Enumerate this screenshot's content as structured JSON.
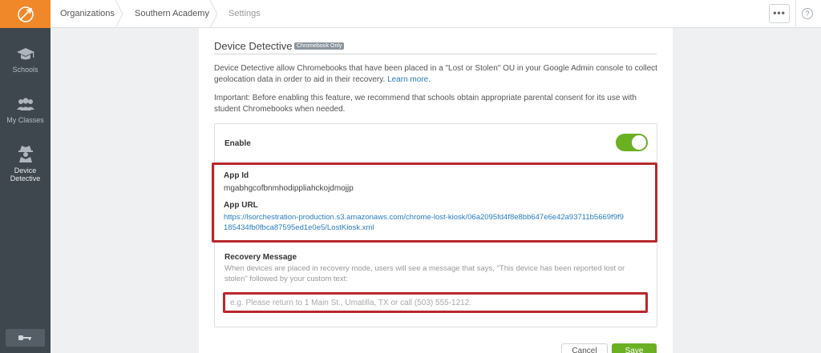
{
  "colors": {
    "accent_orange": "#f0882a",
    "sidebar_bg": "#3e464e",
    "toggle_green": "#6ab023",
    "highlight_red": "#b8282c",
    "link_blue": "#2a7bbf"
  },
  "sidebar": {
    "logo_icon": "compass-logo-icon",
    "items": [
      {
        "label": "Schools",
        "icon": "graduation-cap-icon"
      },
      {
        "label": "My Classes",
        "icon": "group-icon"
      },
      {
        "label": "Device Detective",
        "icon": "detective-icon"
      }
    ],
    "bottom_icon": "key-icon"
  },
  "breadcrumb": [
    "Organizations",
    "Southern Academy",
    "Settings"
  ],
  "topbar": {
    "more_label": "•••",
    "help_label": "?"
  },
  "section": {
    "title": "Device Detective",
    "badge": "Chromebook Only",
    "description": "Device Detective allow Chromebooks that have been placed in a \"Lost or Stolen\" OU in your Google Admin console to collect geolocation data in order to aid in their recovery.",
    "learn_more": "Learn more.",
    "important": "Important: Before enabling this feature, we recommend that schools obtain appropriate parental consent for its use with student Chromebooks when needed."
  },
  "settings": {
    "enable_label": "Enable",
    "enabled": true,
    "app_id_label": "App Id",
    "app_id": "mgabhgcofbnmhodippliahckojdmojjp",
    "app_url_label": "App URL",
    "app_url": "https://lsorchestration-production.s3.amazonaws.com/chrome-lost-kiosk/06a2095fd4f8e8bb647e6e42a93711b5669f9f9185434fb0fbca87595ed1e0e5/LostKiosk.xml",
    "recovery_label": "Recovery Message",
    "recovery_desc": "When devices are placed in recovery mode, users will see a message that says, \"This device has been reported lost or stolen\" followed by your custom text:",
    "recovery_placeholder": "e.g. Please return to 1 Main St., Umatilla, TX or call (503) 555-1212.",
    "recovery_value": ""
  },
  "actions": {
    "cancel": "Cancel",
    "save": "Save"
  }
}
